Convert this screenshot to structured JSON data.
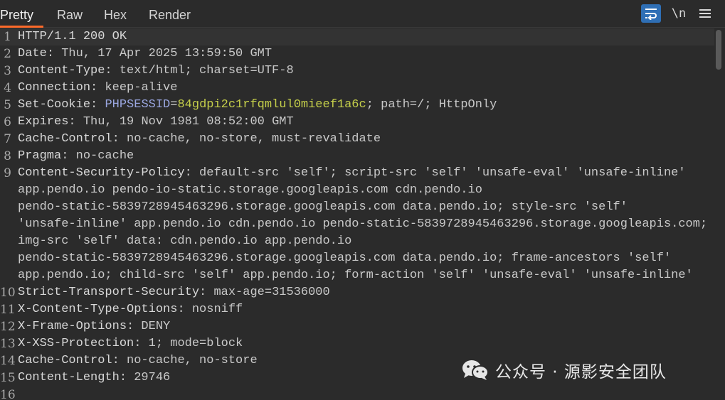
{
  "tabs": [
    {
      "label": "Pretty",
      "active": true
    },
    {
      "label": "Raw",
      "active": false
    },
    {
      "label": "Hex",
      "active": false
    },
    {
      "label": "Render",
      "active": false
    }
  ],
  "toolbar": {
    "wrap_icon": "text-wrap-icon",
    "newline_label": "\\n",
    "menu_icon": "hamburger-menu-icon"
  },
  "lines": [
    {
      "n": "1",
      "key": "HTTP/1.1 200 OK",
      "val": ""
    },
    {
      "n": "2",
      "key": "Date",
      "val": ": Thu, 17 Apr 2025 13:59:50 GMT"
    },
    {
      "n": "3",
      "key": "Content-Type",
      "val": ": text/html; charset=UTF-8"
    },
    {
      "n": "4",
      "key": "Connection",
      "val": ": keep-alive"
    },
    {
      "n": "5",
      "key": "Set-Cookie",
      "val": ": ",
      "cookie_name": "PHPSESSID",
      "cookie_eq": "=",
      "cookie_value": "84gdpi2c1rfqmlul0mieef1a6c",
      "rest": "; path=/; HttpOnly"
    },
    {
      "n": "6",
      "key": "Expires",
      "val": ": Thu, 19 Nov 1981 08:52:00 GMT"
    },
    {
      "n": "7",
      "key": "Cache-Control",
      "val": ": no-cache, no-store, must-revalidate"
    },
    {
      "n": "8",
      "key": "Pragma",
      "val": ": no-cache"
    },
    {
      "n": "9",
      "key": "Content-Security-Policy",
      "val": ": default-src 'self'; script-src 'self' 'unsafe-eval' 'unsafe-inline'"
    },
    {
      "n": "",
      "key": "",
      "val": "app.pendo.io pendo-io-static.storage.googleapis.com cdn.pendo.io"
    },
    {
      "n": "",
      "key": "",
      "val": "pendo-static-5839728945463296.storage.googleapis.com data.pendo.io; style-src 'self'"
    },
    {
      "n": "",
      "key": "",
      "val": "'unsafe-inline' app.pendo.io cdn.pendo.io pendo-static-5839728945463296.storage.googleapis.com;"
    },
    {
      "n": "",
      "key": "",
      "val": "img-src 'self' data: cdn.pendo.io app.pendo.io"
    },
    {
      "n": "",
      "key": "",
      "val": "pendo-static-5839728945463296.storage.googleapis.com data.pendo.io; frame-ancestors 'self'"
    },
    {
      "n": "",
      "key": "",
      "val": "app.pendo.io; child-src 'self' app.pendo.io; form-action 'self' 'unsafe-eval' 'unsafe-inline'"
    },
    {
      "n": "10",
      "key": "Strict-Transport-Security",
      "val": ": max-age=31536000"
    },
    {
      "n": "11",
      "key": "X-Content-Type-Options",
      "val": ": nosniff"
    },
    {
      "n": "12",
      "key": "X-Frame-Options",
      "val": ": DENY"
    },
    {
      "n": "13",
      "key": "X-XSS-Protection",
      "val": ": 1; mode=block"
    },
    {
      "n": "14",
      "key": "Cache-Control",
      "val": ": no-cache, no-store"
    },
    {
      "n": "15",
      "key": "Content-Length",
      "val": ": 29746"
    },
    {
      "n": "16",
      "key": "",
      "val": ""
    }
  ],
  "watermark": {
    "icon": "wechat-icon",
    "text": "公众号 · 源影安全团队"
  }
}
